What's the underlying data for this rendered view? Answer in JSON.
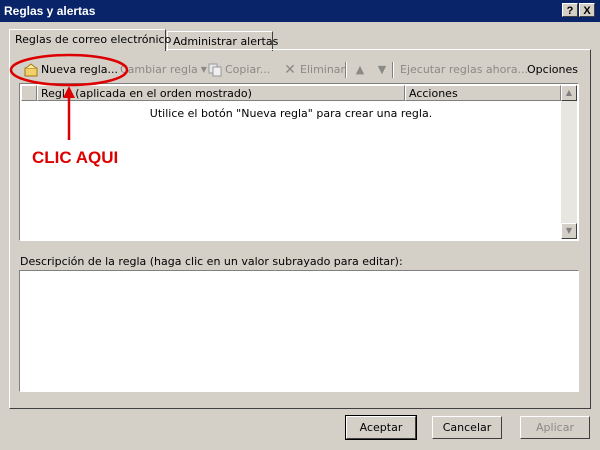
{
  "window": {
    "title": "Reglas y alertas",
    "help_label": "?",
    "close_label": "X"
  },
  "tabs": [
    {
      "label": "Reglas de correo electrónico",
      "active": true
    },
    {
      "label": "Administrar alertas",
      "active": false
    }
  ],
  "toolbar": {
    "new_rule": "Nueva regla...",
    "change_rule": "Cambiar regla",
    "copy": "Copiar...",
    "delete": "Eliminar",
    "run_rules": "Ejecutar reglas ahora...",
    "options": "Opciones"
  },
  "rules_list": {
    "columns": [
      "Regla (aplicada en el orden mostrado)",
      "Acciones"
    ],
    "empty_message": "Utilice el botón \"Nueva regla\" para crear una regla."
  },
  "annotation": {
    "text": "CLIC AQUI",
    "color": "#dd0000"
  },
  "description": {
    "label": "Descripción de la regla (haga clic en un valor subrayado para editar):"
  },
  "buttons": {
    "ok": "Aceptar",
    "cancel": "Cancelar",
    "apply": "Aplicar"
  }
}
